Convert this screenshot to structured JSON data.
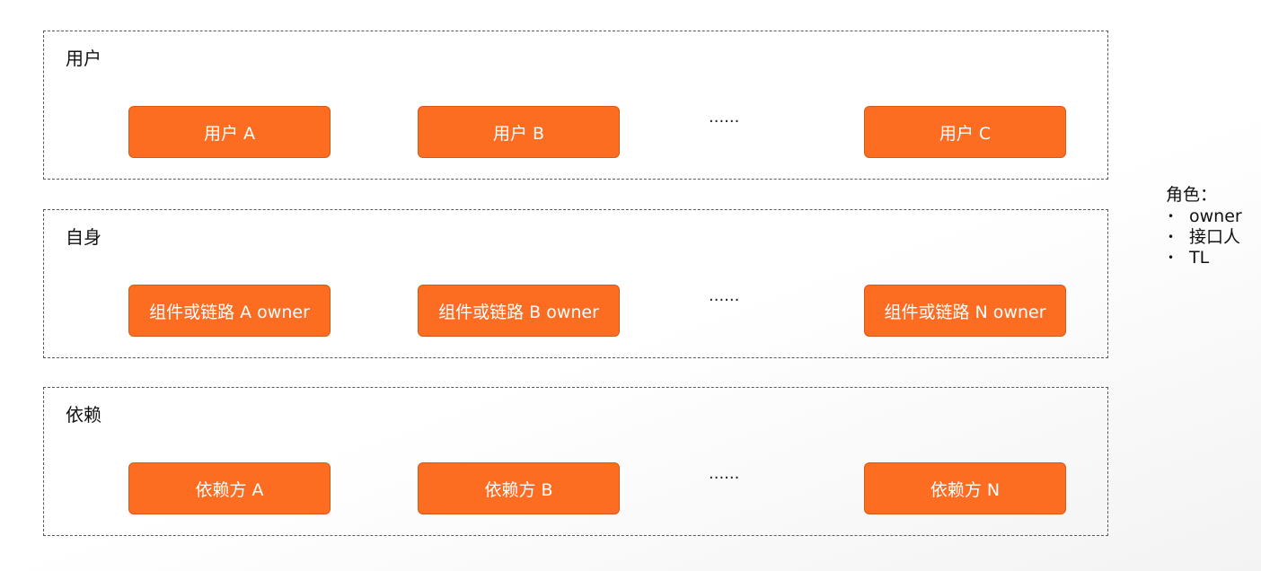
{
  "groups": [
    {
      "title": "用户",
      "nodes": [
        "用户 A",
        "用户 B",
        "用户 C"
      ],
      "ellipsis": "......"
    },
    {
      "title": "自身",
      "nodes": [
        "组件或链路 A owner",
        "组件或链路 B owner",
        "组件或链路 N owner"
      ],
      "ellipsis": "......"
    },
    {
      "title": "依赖",
      "nodes": [
        "依赖方 A",
        "依赖方 B",
        "依赖方 N"
      ],
      "ellipsis": "......"
    }
  ],
  "legend": {
    "title": "角色：",
    "items": [
      "owner",
      "接口人",
      "TL"
    ]
  },
  "colors": {
    "node_fill": "#fc6d22",
    "node_border": "#d55a17",
    "node_text": "#ffffff",
    "dashed_border": "#5a5a5a"
  }
}
